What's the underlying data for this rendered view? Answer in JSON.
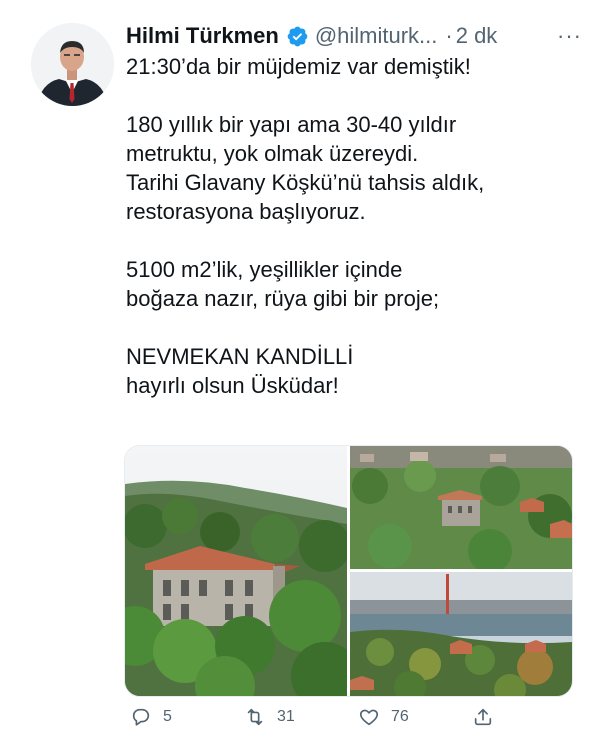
{
  "author": {
    "display_name": "Hilmi Türkmen",
    "handle": "@hilmiturk...",
    "separator": "·",
    "time": "2 dk",
    "more": "···",
    "verified_icon": "verified-badge-icon",
    "verified_color": "#1d9bf0"
  },
  "tweet": {
    "lines_1": [
      "21:30’da bir müjdemiz var demiştik!"
    ],
    "lines_2": [
      "180 yıllık bir yapı ama 30-40 yıldır",
      "metruktu, yok olmak üzereydi.",
      "Tarihi Glavany Köşkü’nü tahsis aldık,",
      "restorasyona başlıyoruz."
    ],
    "lines_3": [
      "5100 m2’lik, yeşillikler içinde",
      "boğaza nazır, rüya gibi bir proje;"
    ],
    "lines_4": [
      "NEVMEKAN KANDİLLİ",
      "hayırlı olsun Üsküdar!"
    ]
  },
  "actions": {
    "reply": {
      "icon": "reply-icon",
      "count": "5"
    },
    "retweet": {
      "icon": "retweet-icon",
      "count": "31"
    },
    "like": {
      "icon": "heart-icon",
      "count": "76"
    },
    "share": {
      "icon": "share-icon"
    }
  },
  "colors": {
    "text": "#0f1419",
    "secondary": "#536471",
    "accent": "#1d9bf0"
  }
}
